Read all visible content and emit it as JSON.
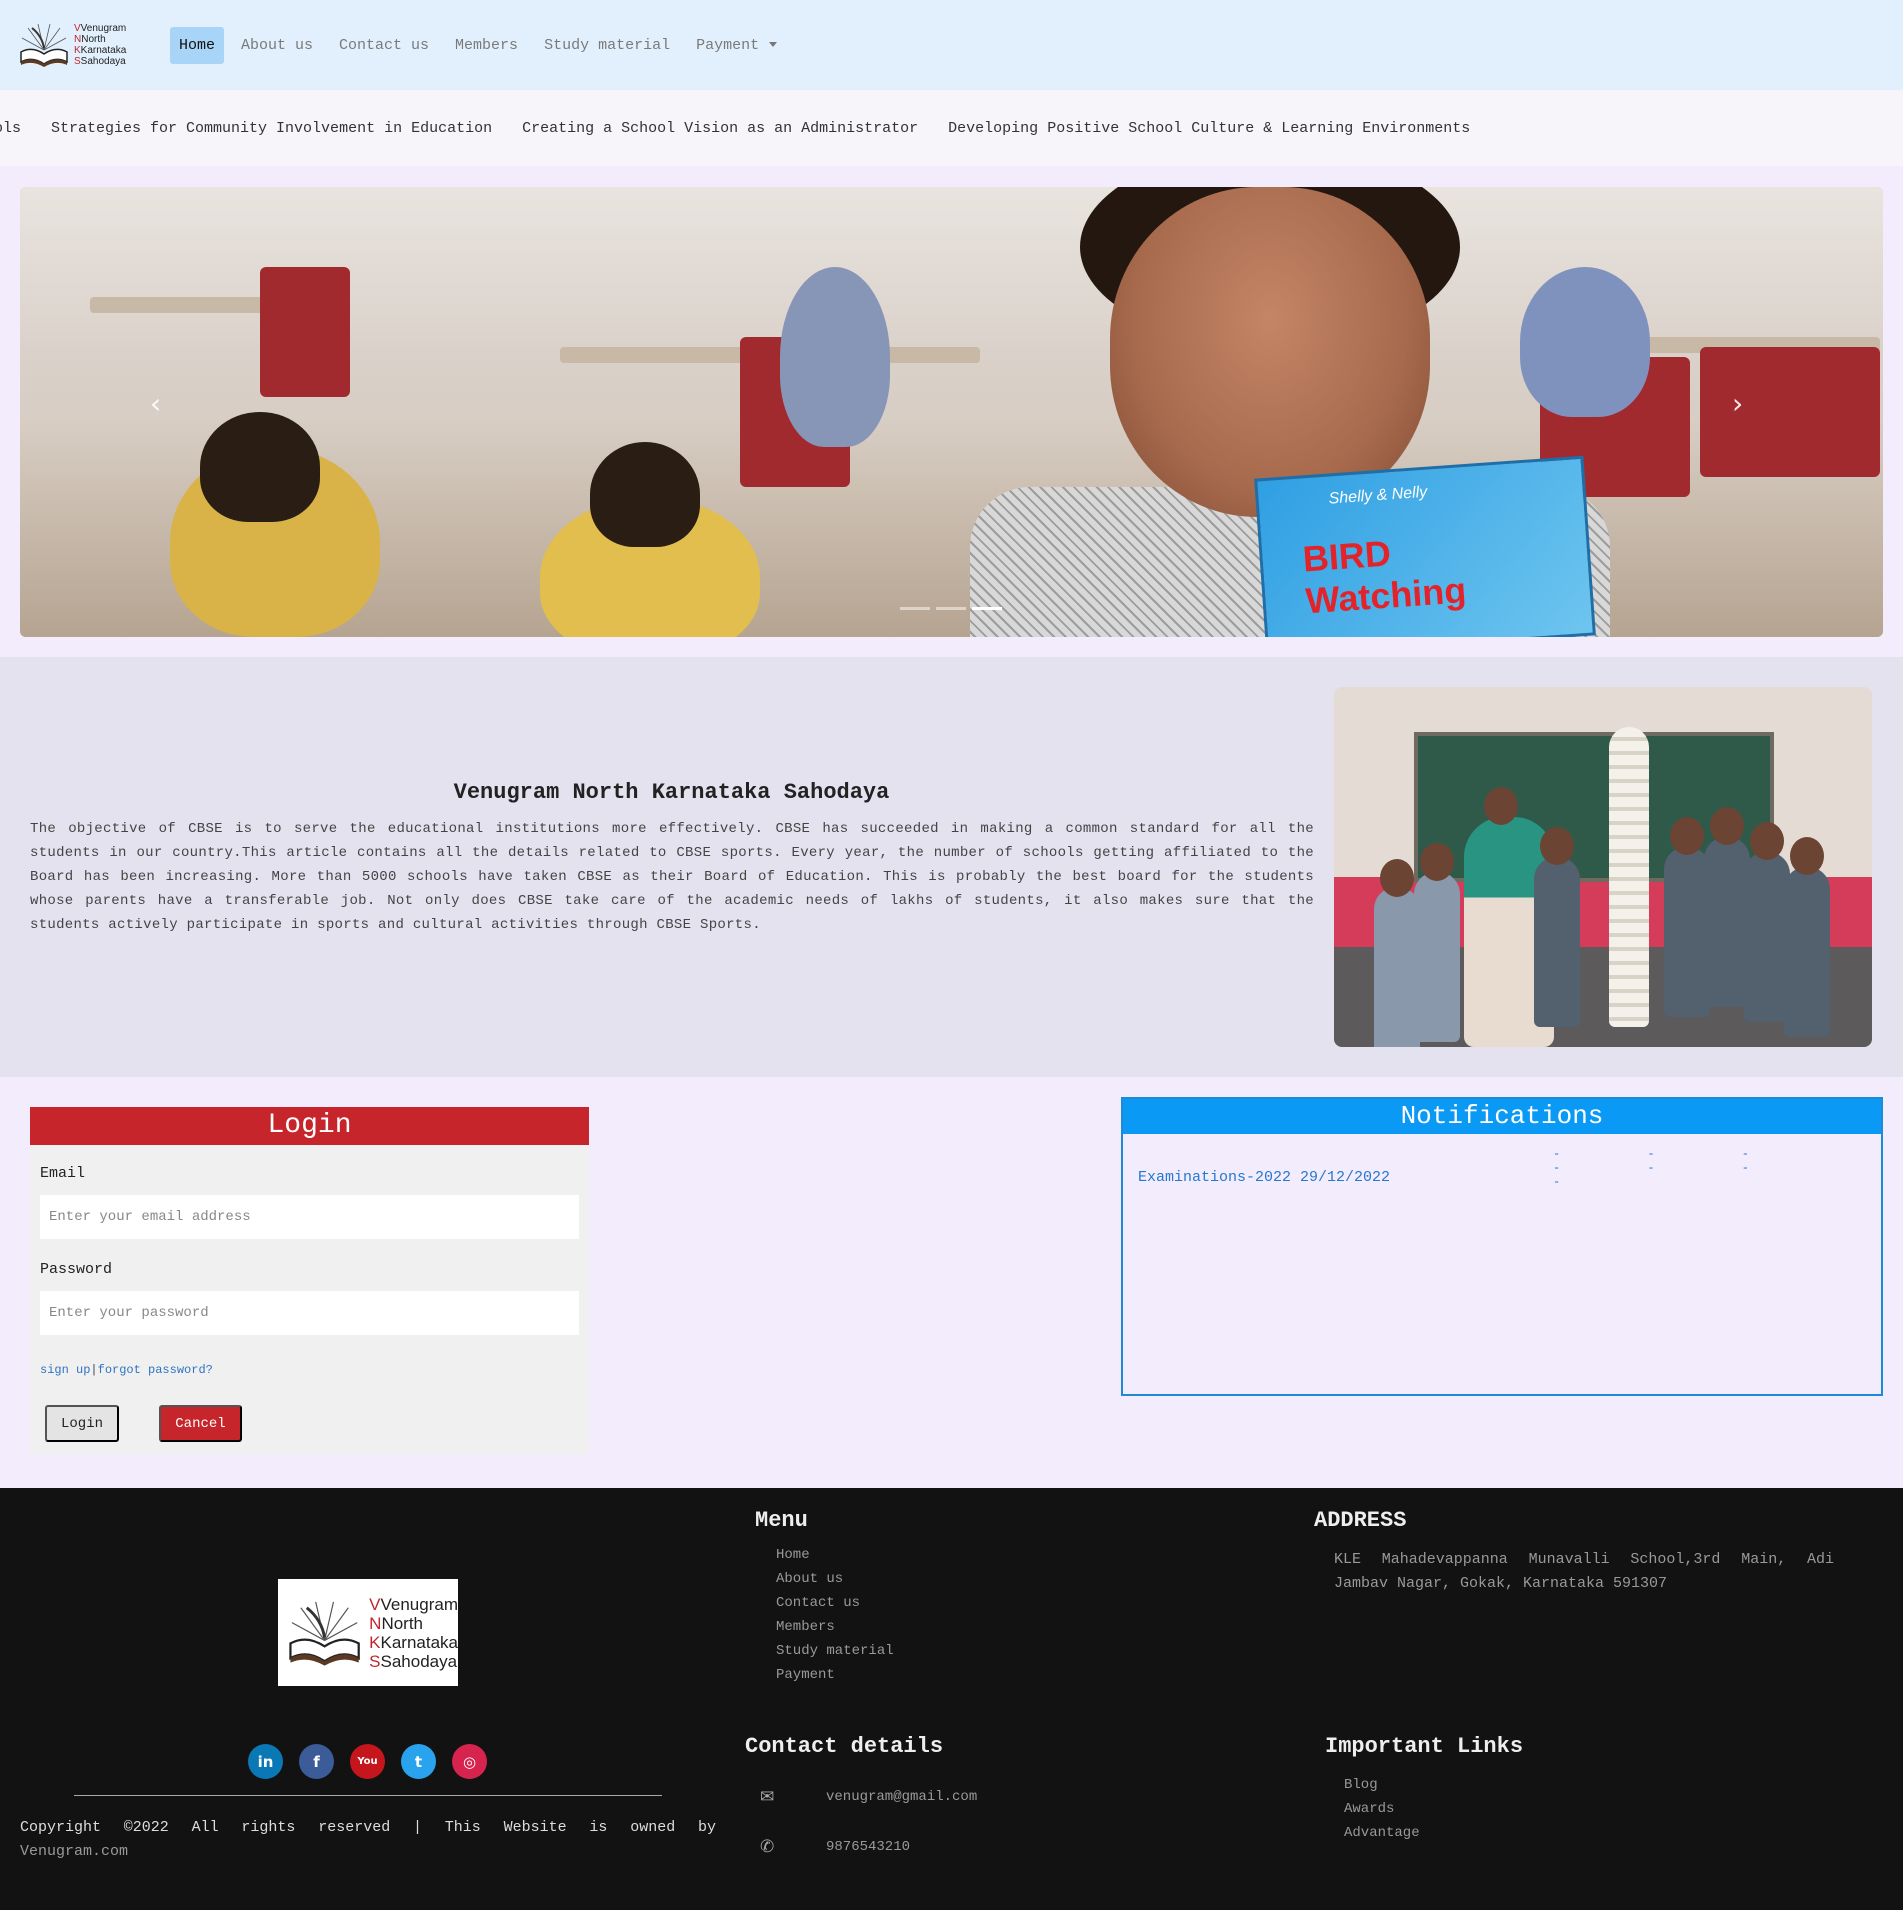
{
  "brand": {
    "line1": "Venugram",
    "line2": "North",
    "line3": "Karnataka",
    "line4": "Sahodaya"
  },
  "nav": {
    "items": [
      "Home",
      "About us",
      "Contact us",
      "Members",
      "Study material",
      "Payment"
    ]
  },
  "ticker": {
    "items": [
      "ols",
      "Strategies for Community Involvement in Education",
      "Creating a School Vision as an Administrator",
      "Developing Positive School Culture & Learning Environments"
    ]
  },
  "carousel": {
    "book_subtitle": "Shelly & Nelly",
    "book_title_1": "BIRD",
    "book_title_2": "Watching",
    "prev_glyph": "‹",
    "next_glyph": "›",
    "slide_count": 3,
    "active_slide": 3
  },
  "about": {
    "title": "Venugram North Karnataka Sahodaya",
    "text": "The objective of CBSE is to serve the educational institutions more effectively. CBSE has succeeded in making a common standard for all the students in our country.This article contains all the details related to CBSE sports. Every year, the number of schools getting affiliated to the Board has been increasing. More than 5000 schools have taken CBSE as their Board of Education. This is probably the best board for the students whose parents have a transferable job. Not only does CBSE take care of the academic needs of lakhs of students, it also makes sure that the students actively participate in sports and cultural activities through CBSE Sports."
  },
  "login": {
    "title": "Login",
    "email_label": "Email",
    "email_placeholder": "Enter your email address",
    "password_label": "Password",
    "password_placeholder": "Enter your password",
    "signup_link": "sign up",
    "separator": "|",
    "forgot_link": "forgot password?",
    "login_button": "Login",
    "cancel_button": "Cancel"
  },
  "notifications": {
    "title": "Notifications",
    "partial": "- - - - - - -",
    "item": "Examinations-2022 29/12/2022"
  },
  "footer": {
    "menu_heading": "Menu",
    "menu_items": [
      "Home",
      "About us",
      "Contact us",
      "Members",
      "Study material",
      "Payment"
    ],
    "address_heading": "ADDRESS",
    "address": "KLE Mahadevappanna Munavalli School,3rd Main, Adi Jambav Nagar, Gokak, Karnataka 591307",
    "contact_heading": "Contact details",
    "email": "venugram@gmail.com",
    "phone": "9876543210",
    "links_heading": "Important Links",
    "links": [
      "Blog",
      "Awards",
      "Advantage"
    ],
    "copyright": "Copyright ©2022 All rights reserved | This Website is owned by",
    "owner": "Venugram.com",
    "socials": [
      {
        "name": "linkedin",
        "glyph": "in",
        "color": "#0a78b5"
      },
      {
        "name": "facebook",
        "glyph": "f",
        "color": "#3c5b99"
      },
      {
        "name": "youtube",
        "glyph": "You",
        "color": "#c4161c"
      },
      {
        "name": "twitter",
        "glyph": "t",
        "color": "#2aa3ef"
      },
      {
        "name": "instagram",
        "glyph": "◎",
        "color": "#d7244e"
      }
    ]
  }
}
